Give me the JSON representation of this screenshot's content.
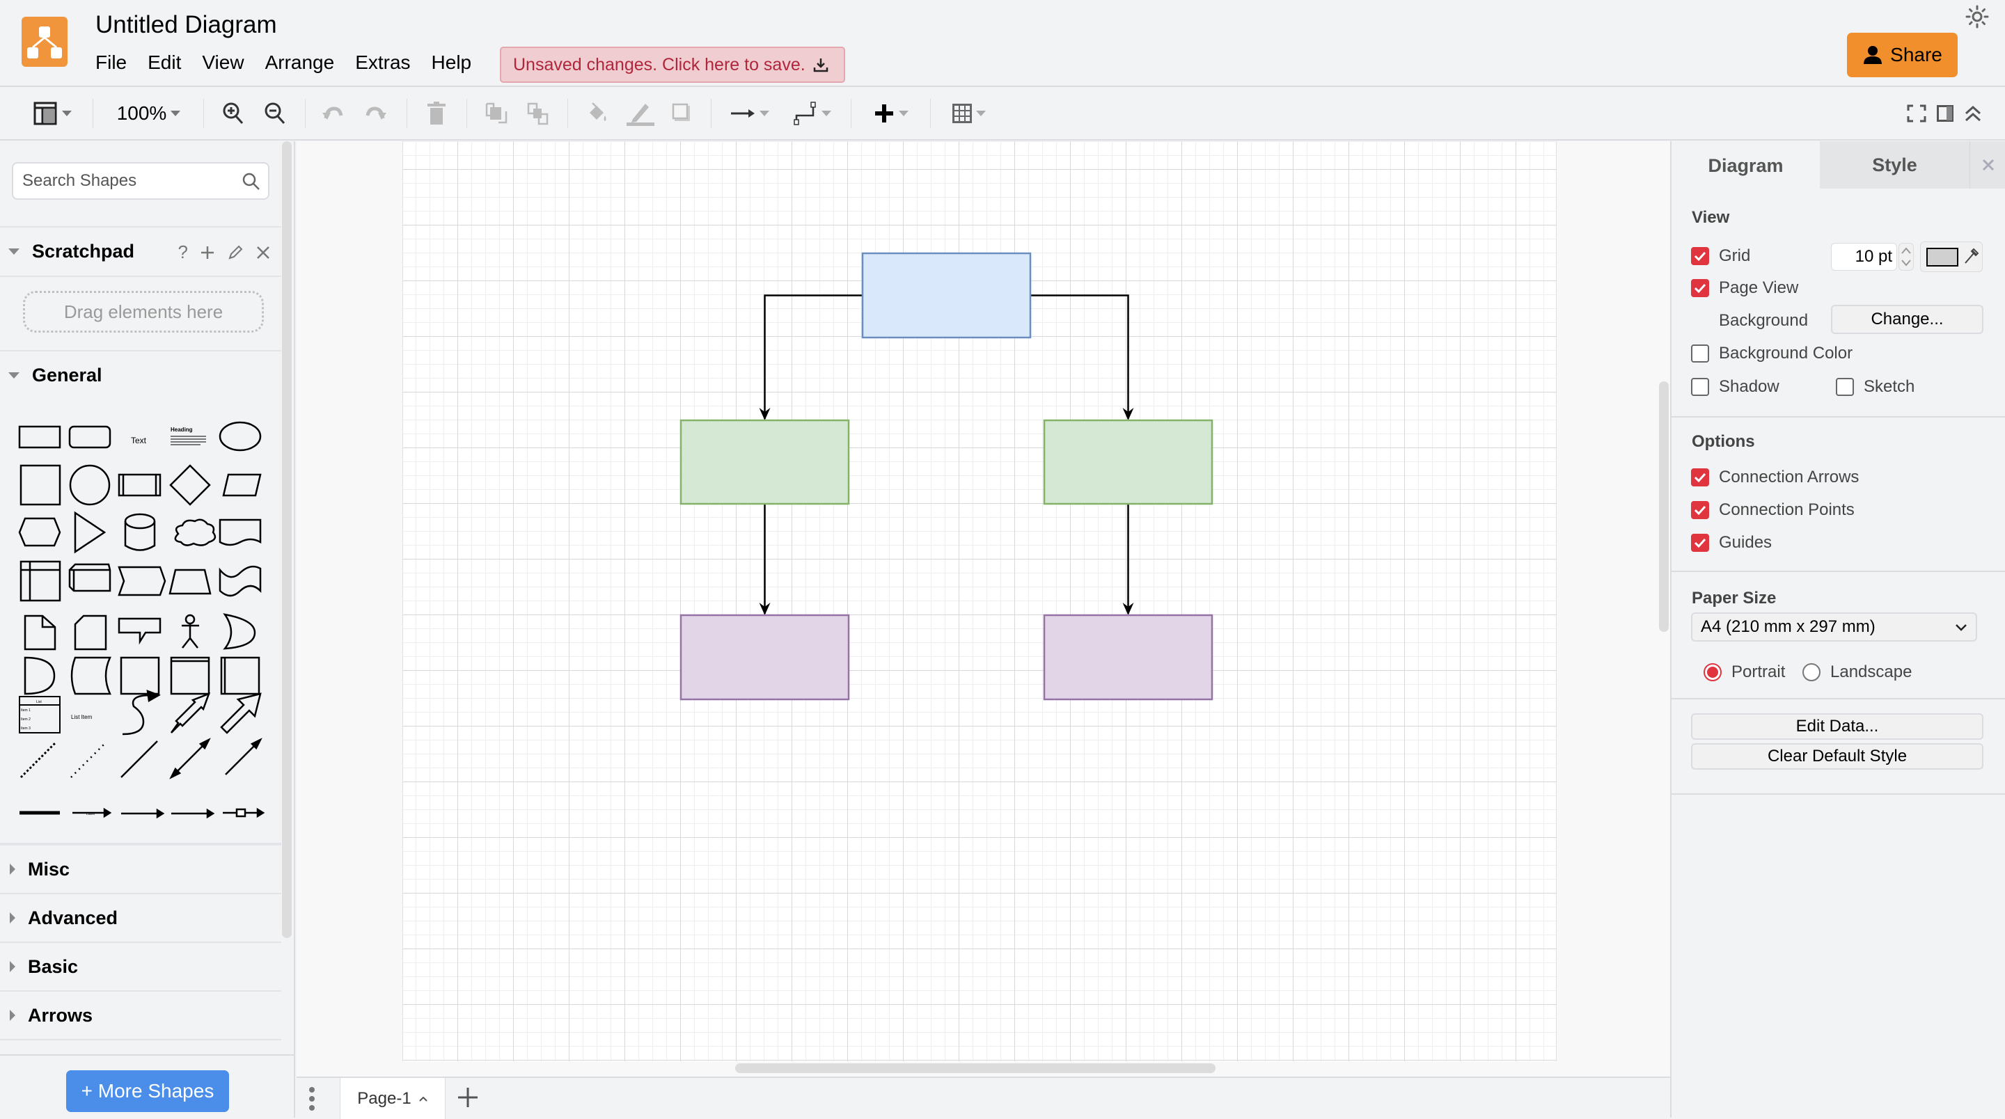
{
  "app": {
    "title": "Untitled Diagram",
    "brand_color": "#f0953c",
    "menus": [
      "File",
      "Edit",
      "View",
      "Arrange",
      "Extras",
      "Help"
    ],
    "unsaved_banner": "Unsaved changes. Click here to save.",
    "share_label": "Share"
  },
  "toolbar": {
    "zoom_level": "100%",
    "icons": [
      "format-panel-icon",
      "zoom-in-icon",
      "zoom-out-icon",
      "undo-icon",
      "redo-icon",
      "delete-icon",
      "to-front-icon",
      "to-back-icon",
      "fill-color-icon",
      "line-color-icon",
      "shadow-icon",
      "connection-icon",
      "waypoints-icon",
      "insert-icon",
      "table-icon",
      "fullscreen-icon",
      "toggle-panel-icon",
      "collapse-icon"
    ]
  },
  "sidebar": {
    "search_placeholder": "Search Shapes",
    "scratchpad": {
      "title": "Scratchpad",
      "help": "?",
      "dropzone": "Drag elements here"
    },
    "general": {
      "title": "General",
      "text_shape": "Text",
      "heading_shape": "Heading",
      "list_shape": "List",
      "list_items": [
        "Item 1",
        "Item 2",
        "Item 3"
      ],
      "list_item_shape": "List Item",
      "label_shape": "Label"
    },
    "collapsed_sections": [
      "Misc",
      "Advanced",
      "Basic",
      "Arrows"
    ],
    "more_shapes_label": "+ More Shapes"
  },
  "canvas": {
    "shapes": [
      {
        "id": "root",
        "fill": "#dae8fc",
        "stroke": "#6c8ebf"
      },
      {
        "id": "left-child",
        "fill": "#d5e8d4",
        "stroke": "#82b366"
      },
      {
        "id": "right-child",
        "fill": "#d5e8d4",
        "stroke": "#82b366"
      },
      {
        "id": "left-grandchild",
        "fill": "#e1d5e7",
        "stroke": "#9673a6"
      },
      {
        "id": "right-grandchild",
        "fill": "#e1d5e7",
        "stroke": "#9673a6"
      }
    ],
    "edges": [
      {
        "from": "root",
        "to": "left-child"
      },
      {
        "from": "root",
        "to": "right-child"
      },
      {
        "from": "left-child",
        "to": "left-grandchild"
      },
      {
        "from": "right-child",
        "to": "right-grandchild"
      }
    ]
  },
  "pages": {
    "tabs": [
      "Page-1"
    ]
  },
  "format_panel": {
    "tabs": [
      "Diagram",
      "Style"
    ],
    "view": {
      "heading": "View",
      "grid": {
        "label": "Grid",
        "checked": true,
        "size": "10 pt",
        "color": "#d0d0d0"
      },
      "page_view": {
        "label": "Page View",
        "checked": true
      },
      "background": {
        "label": "Background",
        "button": "Change..."
      },
      "background_color": {
        "label": "Background Color",
        "checked": false
      },
      "shadow": {
        "label": "Shadow",
        "checked": false
      },
      "sketch": {
        "label": "Sketch",
        "checked": false
      }
    },
    "options": {
      "heading": "Options",
      "items": [
        {
          "label": "Connection Arrows",
          "checked": true
        },
        {
          "label": "Connection Points",
          "checked": true
        },
        {
          "label": "Guides",
          "checked": true
        }
      ]
    },
    "paper_size": {
      "heading": "Paper Size",
      "selected": "A4 (210 mm x 297 mm)",
      "orientation": {
        "portrait": "Portrait",
        "landscape": "Landscape",
        "selected": "Portrait"
      }
    },
    "buttons": {
      "edit_data": "Edit Data...",
      "clear_style": "Clear Default Style"
    },
    "accent_color": "#e0353f"
  }
}
